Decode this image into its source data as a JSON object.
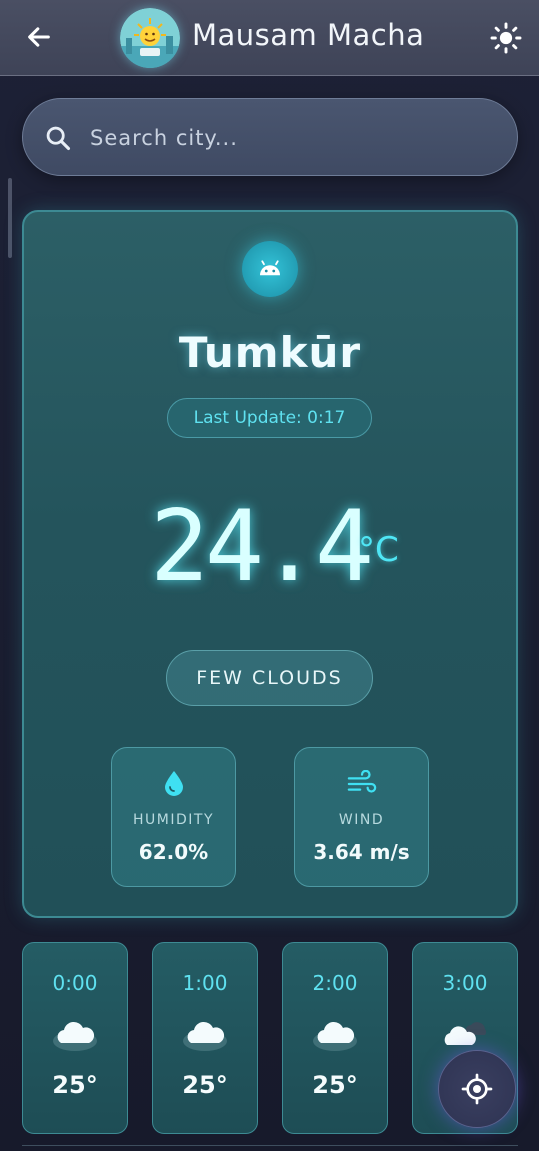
{
  "header": {
    "title": "Mausam Macha",
    "back_icon": "arrow-left-icon",
    "theme_icon": "sun-icon"
  },
  "search": {
    "placeholder": "Search city...",
    "value": ""
  },
  "current": {
    "city": "Tumkūr",
    "last_update": "Last Update: 0:17",
    "temperature": "24.4",
    "unit": "°C",
    "condition": "FEW CLOUDS",
    "platform_icon": "android-icon"
  },
  "stats": {
    "humidity_label": "HUMIDITY",
    "humidity_value": "62.0%",
    "wind_label": "WIND",
    "wind_value": "3.64 m/s"
  },
  "hourly": [
    {
      "time": "0:00",
      "temp": "25°",
      "icon": "cloud-icon"
    },
    {
      "time": "1:00",
      "temp": "25°",
      "icon": "cloud-icon"
    },
    {
      "time": "2:00",
      "temp": "25°",
      "icon": "cloud-icon"
    },
    {
      "time": "3:00",
      "temp": "",
      "icon": "cloud-rain-icon"
    }
  ],
  "colors": {
    "accent": "#5fe1f0",
    "card": "#24545c",
    "background": "#1a1d30"
  }
}
